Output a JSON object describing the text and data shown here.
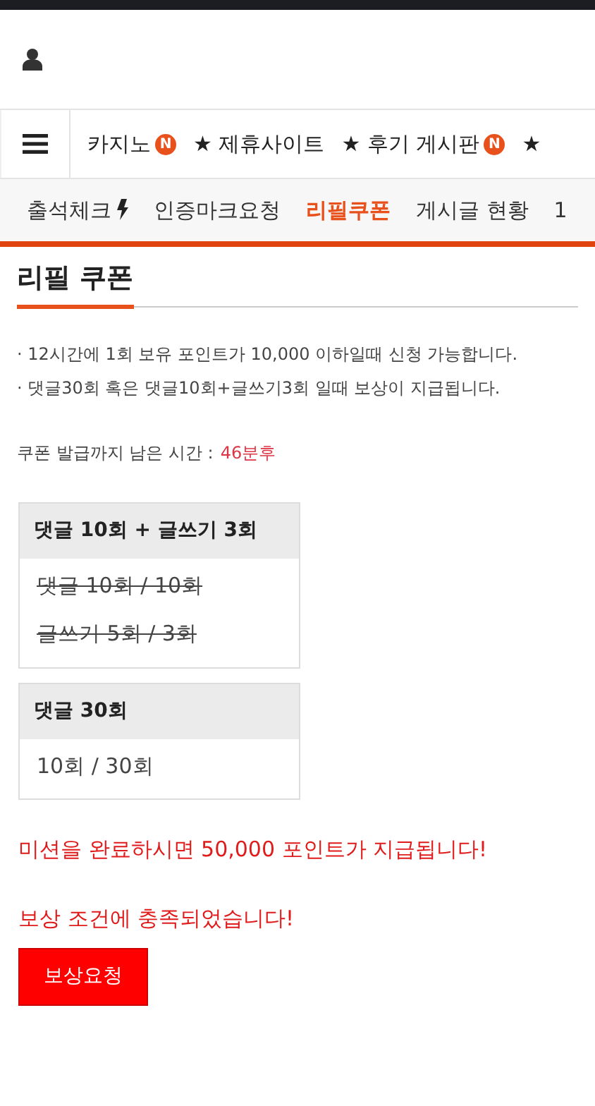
{
  "nav": [
    {
      "label": "카지노",
      "badge": "N"
    },
    {
      "label": "★ 제휴사이트"
    },
    {
      "label": "★ 후기 게시판",
      "badge": "N"
    },
    {
      "label": "★"
    }
  ],
  "subnav": [
    {
      "label": "출석체크",
      "kind": "bolt",
      "selected": false
    },
    {
      "label": "인증마크요청",
      "kind": "plain",
      "selected": false
    },
    {
      "label": "리필쿠폰",
      "kind": "plain",
      "selected": true
    },
    {
      "label": "게시글 현황",
      "kind": "plain",
      "selected": false
    },
    {
      "label": "1",
      "kind": "plain",
      "selected": false
    }
  ],
  "title": "리필 쿠폰",
  "notes": [
    "· 12시간에 1회 보유 포인트가 10,000 이하일때 신청 가능합니다.",
    "· 댓글30회 혹은 댓글10회+글쓰기3회 일때 보상이 지급됩니다."
  ],
  "timer": {
    "label": "쿠폰 발급까지 남은 시간 :",
    "value": "46분후"
  },
  "missions": [
    {
      "title": "댓글 10회 + 글쓰기 3회",
      "lines": [
        {
          "text": "댓글 10회 / 10회",
          "done": true
        },
        {
          "text": "글쓰기 5회 / 3회",
          "done": true
        }
      ]
    },
    {
      "title": "댓글 30회",
      "lines": [
        {
          "text": "10회 / 30회",
          "done": false
        }
      ]
    }
  ],
  "messages": [
    "미션을 완료하시면 50,000 포인트가 지급됩니다!",
    "보상 조건에 충족되었습니다!"
  ],
  "button": "보상요청"
}
